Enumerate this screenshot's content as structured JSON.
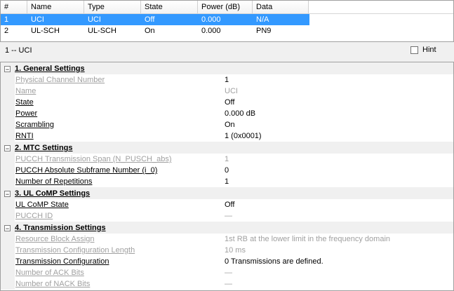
{
  "table": {
    "headers": [
      "#",
      "Name",
      "Type",
      "State",
      "Power (dB)",
      "Data"
    ],
    "rows": [
      [
        "1",
        "UCI",
        "UCI",
        "Off",
        "0.000",
        "N/A"
      ],
      [
        "2",
        "UL-SCH",
        "UL-SCH",
        "On",
        "0.000",
        "PN9"
      ]
    ]
  },
  "caption": "1 -- UCI",
  "hint": {
    "label": "Hint"
  },
  "grid": {
    "categories": [
      {
        "title": "1. General Settings",
        "toggle": "−",
        "props": [
          {
            "name": "Physical Channel Number",
            "value": "1",
            "name_disabled": true
          },
          {
            "name": "Name",
            "value": "UCI",
            "name_disabled": true,
            "value_disabled": true
          },
          {
            "name": "State",
            "value": "Off"
          },
          {
            "name": "Power",
            "value": "0.000 dB"
          },
          {
            "name": "Scrambling",
            "value": "On"
          },
          {
            "name": "RNTI",
            "value": "1 (0x0001)"
          }
        ]
      },
      {
        "title": "2. MTC Settings",
        "toggle": "−",
        "props": [
          {
            "name": "PUCCH Transmission Span (N_PUSCH_abs)",
            "value": "1",
            "name_disabled": true,
            "value_disabled": true
          },
          {
            "name": "PUCCH Absolute Subframe Number (i_0)",
            "value": "0"
          },
          {
            "name": "Number of Repetitions",
            "value": "1"
          }
        ]
      },
      {
        "title": "3. UL CoMP Settings",
        "toggle": "−",
        "props": [
          {
            "name": "UL CoMP State",
            "value": "Off"
          },
          {
            "name": "PUCCH ID",
            "value": "—",
            "name_disabled": true,
            "value_disabled": true
          }
        ]
      },
      {
        "title": "4. Transmission Settings",
        "toggle": "−",
        "props": [
          {
            "name": "Resource Block Assign",
            "value": "1st RB at the lower limit in the frequency domain",
            "name_disabled": true,
            "value_disabled": true
          },
          {
            "name": "Transmission Configuration Length",
            "value": "10 ms",
            "name_disabled": true,
            "value_disabled": true
          },
          {
            "name": "Transmission Configuration",
            "value": "0 Transmissions are defined."
          },
          {
            "name": "Number of ACK Bits",
            "value": "—",
            "name_disabled": true,
            "value_disabled": true
          },
          {
            "name": "Number of NACK Bits",
            "value": "—",
            "name_disabled": true,
            "value_disabled": true
          }
        ]
      }
    ]
  }
}
